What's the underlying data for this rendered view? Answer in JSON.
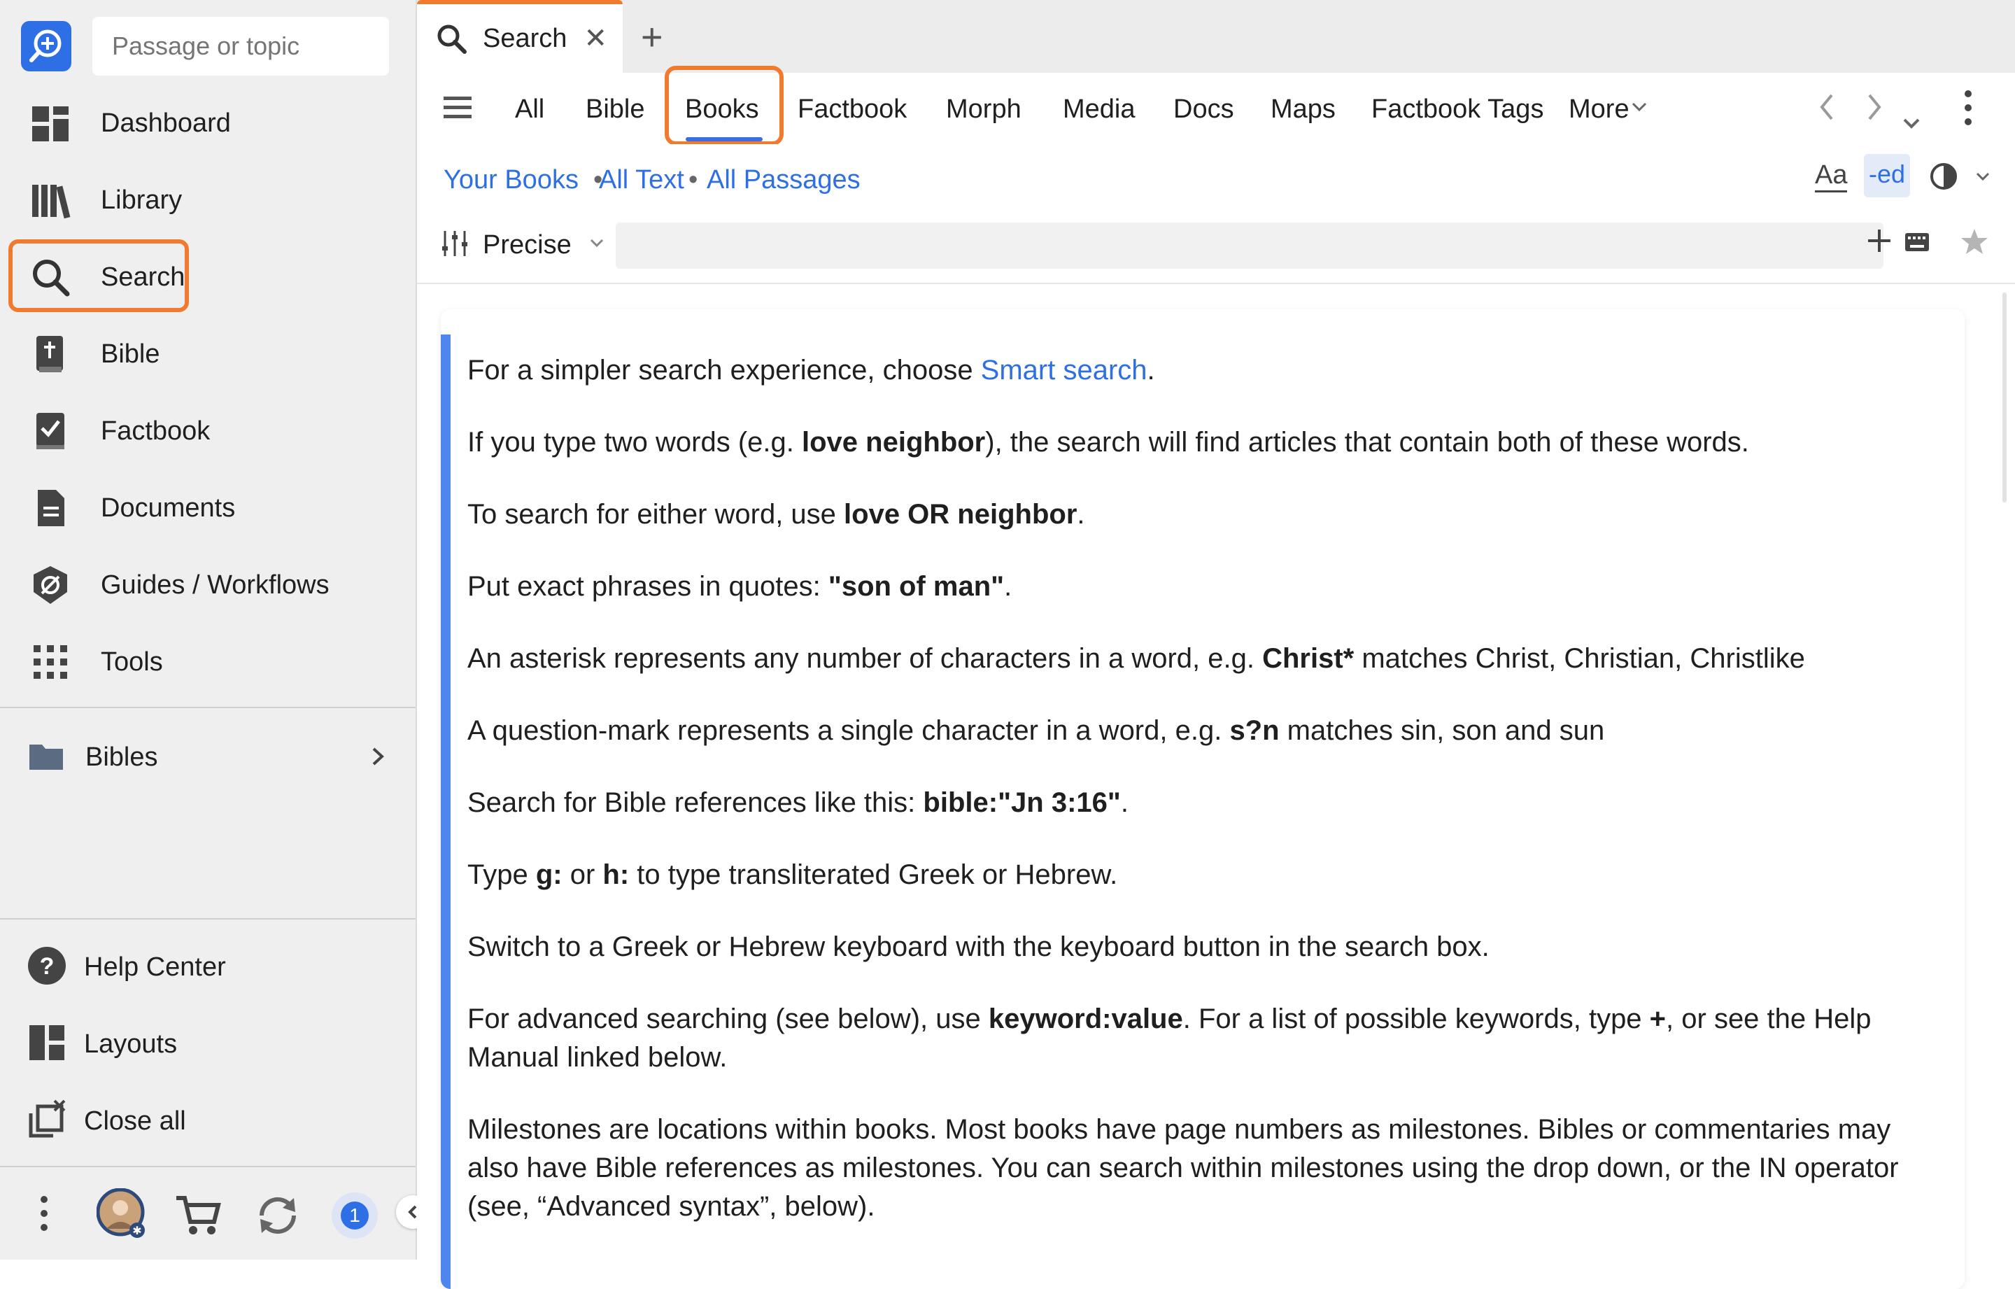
{
  "sidebar": {
    "search_placeholder": "Passage or topic",
    "items": [
      {
        "label": "Dashboard",
        "icon": "dashboard-icon"
      },
      {
        "label": "Library",
        "icon": "library-icon"
      },
      {
        "label": "Search",
        "icon": "search-icon"
      },
      {
        "label": "Bible",
        "icon": "bible-icon"
      },
      {
        "label": "Factbook",
        "icon": "factbook-icon"
      },
      {
        "label": "Documents",
        "icon": "document-icon"
      },
      {
        "label": "Guides / Workflows",
        "icon": "guides-icon"
      },
      {
        "label": "Tools",
        "icon": "grid-icon"
      }
    ],
    "folder": {
      "label": "Bibles",
      "icon": "folder-icon"
    },
    "bottom_items": [
      {
        "label": "Help Center",
        "icon": "help-icon"
      },
      {
        "label": "Layouts",
        "icon": "layouts-icon"
      },
      {
        "label": "Close all",
        "icon": "close-all-icon"
      }
    ],
    "notification_count": "1"
  },
  "tab": {
    "label": "Search"
  },
  "filters": [
    "All",
    "Bible",
    "Books",
    "Factbook",
    "Morph",
    "Media",
    "Docs",
    "Maps",
    "Factbook Tags",
    "More"
  ],
  "active_filter": "Books",
  "scope": {
    "library": "Your Books",
    "text": "All Text",
    "passages": "All Passages"
  },
  "query": {
    "mode": "Precise",
    "value": ""
  },
  "text_tools": {
    "font_label": "Aa",
    "ed_label": "-ed"
  },
  "colors": {
    "accent": "#2f6fe6",
    "highlight": "#f07b2f"
  },
  "help": {
    "p1_pre": "For a simpler search experience, choose ",
    "p1_link": "Smart search",
    "p1_post": ".",
    "p2_pre": "If you type two words (e.g. ",
    "p2_bold": "love neighbor",
    "p2_post": "), the search will find articles that contain both of these words.",
    "p3_pre": "To search for either word, use ",
    "p3_bold": "love OR neighbor",
    "p3_post": ".",
    "p4_pre": "Put exact phrases in quotes: ",
    "p4_bold": "\"son of man\"",
    "p4_post": ".",
    "p5_pre": "An asterisk represents any number of characters in a word, e.g. ",
    "p5_bold": "Christ*",
    "p5_post": " matches Christ, Christian, Christlike",
    "p6_pre": "A question-mark represents a single character in a word, e.g. ",
    "p6_bold": "s?n",
    "p6_post": " matches sin, son and sun",
    "p7_pre": "Search for Bible references like this: ",
    "p7_bold": "bible:\"Jn 3:16\"",
    "p7_post": ".",
    "p8_pre": "Type ",
    "p8_bold1": "g:",
    "p8_mid": " or ",
    "p8_bold2": "h:",
    "p8_post": " to type transliterated Greek or Hebrew.",
    "p9": "Switch to a Greek or Hebrew keyboard with the keyboard button in the search box.",
    "p10_pre": "For advanced searching (see below), use ",
    "p10_bold1": "keyword:value",
    "p10_mid": ". For a list of possible keywords, type ",
    "p10_bold2": "+",
    "p10_post": ", or see the Help Manual linked below.",
    "p11": "Milestones are locations within books. Most books have page numbers as milestones. Bibles or commentaries may also have Bible references as milestones. You can search within milestones using the drop down, or the IN operator (see, “Advanced syntax”, below)."
  }
}
